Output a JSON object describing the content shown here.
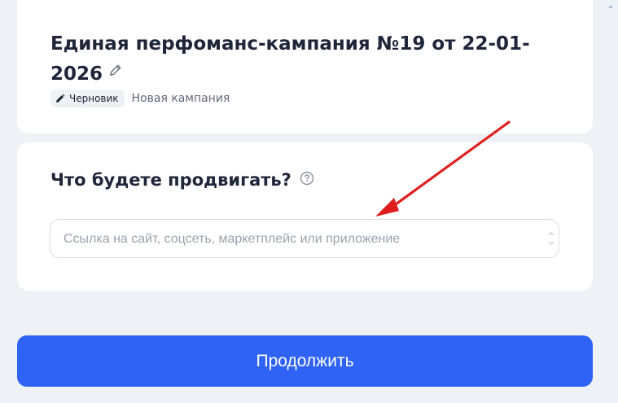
{
  "campaign": {
    "title": "Единая перфоманс-кампания №19 от 22-01-2026",
    "status_badge": "Черновик",
    "note": "Новая кампания"
  },
  "promo_section": {
    "title": "Что будете продвигать?",
    "input_placeholder": "Ссылка на сайт, соцсеть, маркетплейс или приложение",
    "input_value": ""
  },
  "footer": {
    "continue_label": "Продолжить"
  },
  "icons": {
    "edit": "pencil-icon",
    "badge": "pencil-icon",
    "help": "question-circle-icon",
    "annotation": "red-arrow-icon"
  },
  "colors": {
    "page_background": "#eef1f6",
    "card_background": "#ffffff",
    "primary_button": "#2f63f6",
    "annotation_arrow": "#e01e1e",
    "muted_text": "#61677a"
  }
}
